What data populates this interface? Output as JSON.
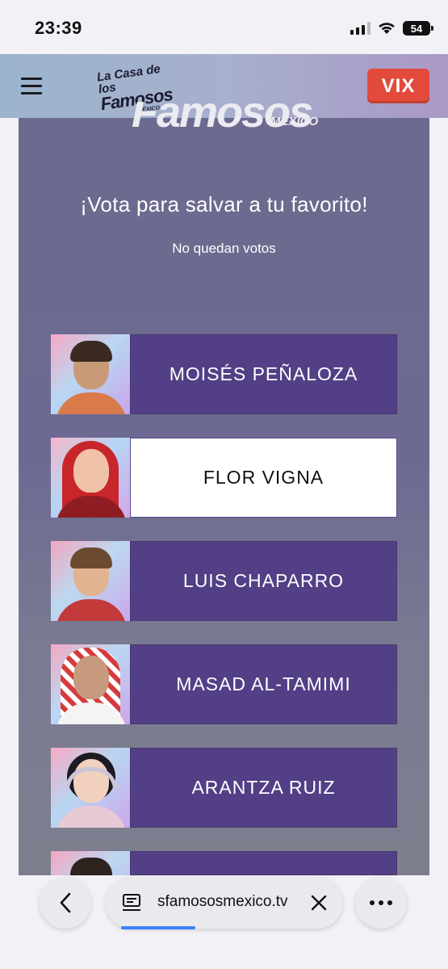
{
  "status_bar": {
    "time": "23:39",
    "battery": "54",
    "signal_bars": 3,
    "icons": [
      "signal-icon",
      "wifi-icon",
      "battery-icon"
    ]
  },
  "header": {
    "menu_icon": "hamburger-icon",
    "logo": {
      "line1": "La Casa de los",
      "line2": "Famosos",
      "line3": "MÉXICO"
    },
    "partner_logo": "VIX"
  },
  "hero": {
    "bg_logo_big": "Famosos",
    "bg_logo_small": "MÉXICO"
  },
  "vote": {
    "title": "¡Vota para salvar a tu favorito!",
    "subtitle": "No quedan votos"
  },
  "candidates": [
    {
      "name": "MOISÉS PEÑALOZA",
      "selected": false
    },
    {
      "name": "FLOR VIGNA",
      "selected": true
    },
    {
      "name": "LUIS CHAPARRO",
      "selected": false
    },
    {
      "name": "MASAD AL-TAMIMI",
      "selected": false
    },
    {
      "name": "ARANTZA RUIZ",
      "selected": false
    },
    {
      "name": "",
      "selected": false
    }
  ],
  "browser": {
    "url": "sfamosossmexico.tv",
    "url_display": "sfamososmexico.tv",
    "icons": [
      "back-icon",
      "reader-icon",
      "close-icon",
      "more-icon"
    ]
  },
  "colors": {
    "accent_purple": "#533f86",
    "vix_red": "#e24a3b",
    "panel": "#6c6a8e"
  }
}
